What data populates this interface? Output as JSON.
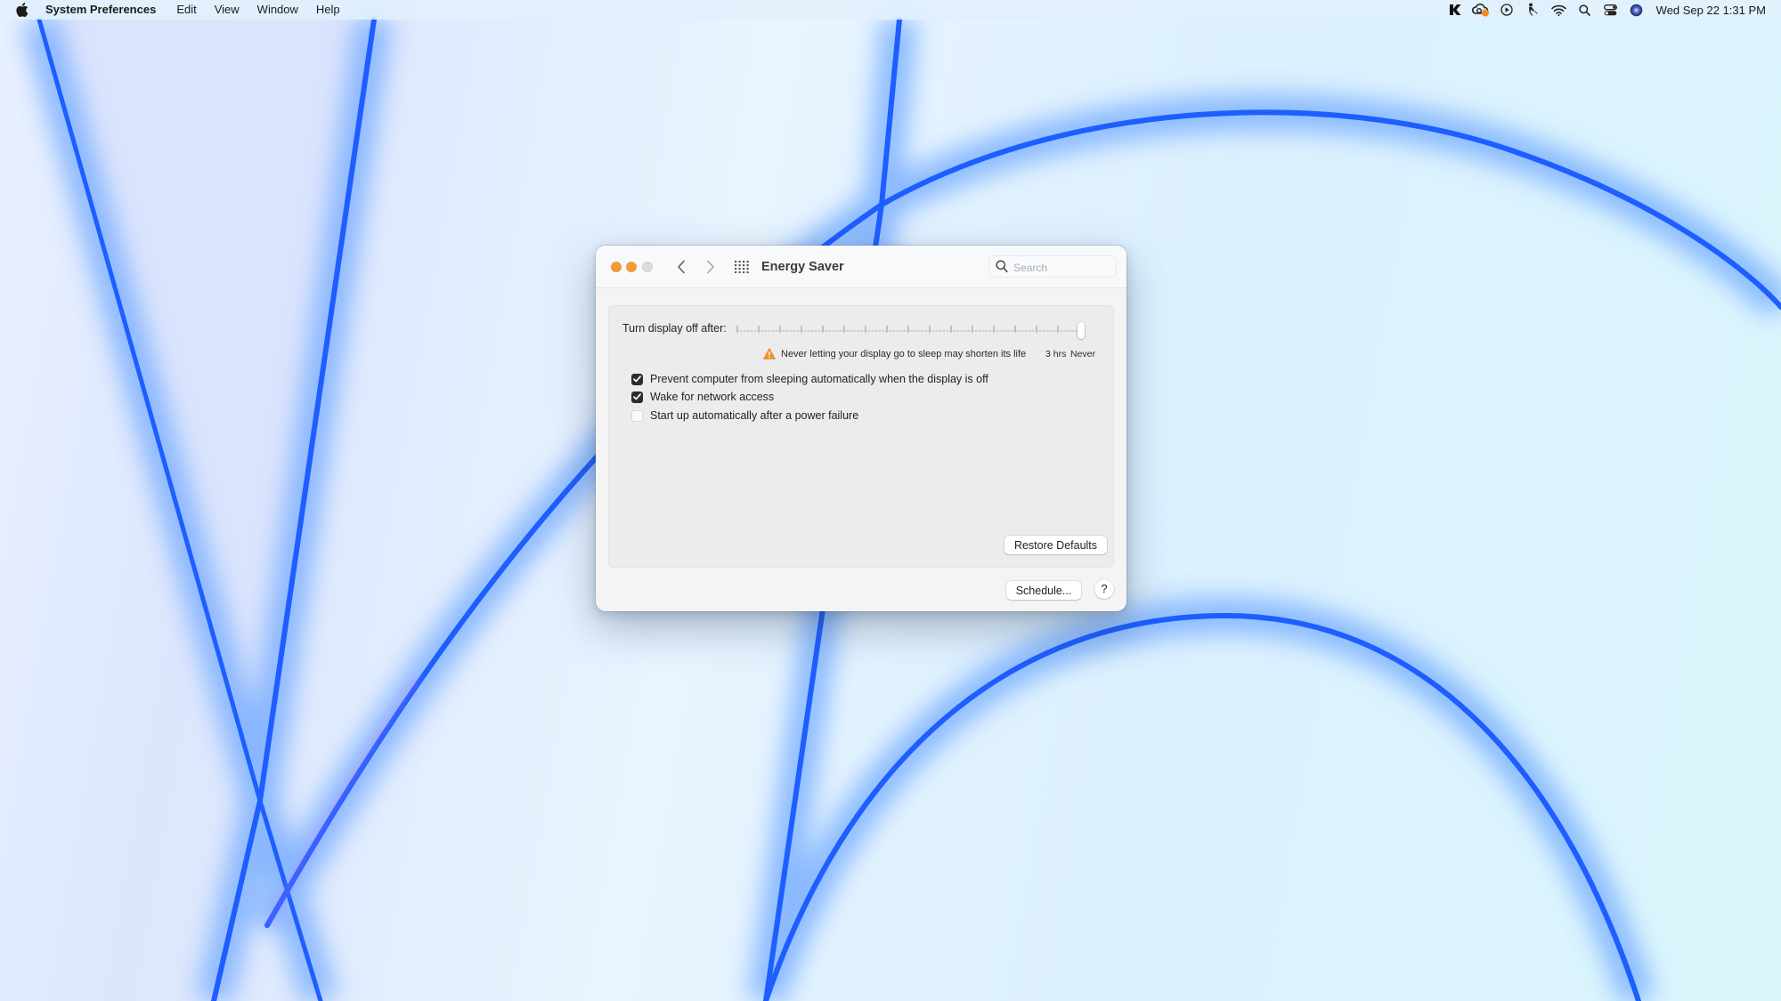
{
  "menubar": {
    "apple_icon": "apple-logo-icon",
    "app_name": "System Preferences",
    "menus": [
      "Edit",
      "View",
      "Window",
      "Help"
    ],
    "status_icons": [
      "klokki-icon",
      "creative-cloud-icon",
      "play-circle-icon",
      "voice-control-icon",
      "wifi-icon",
      "spotlight-search-icon",
      "control-center-icon",
      "siri-icon"
    ],
    "clock": "Wed Sep 22  1:31 PM"
  },
  "window": {
    "title": "Energy Saver",
    "search": {
      "placeholder": "Search",
      "value": ""
    },
    "slider": {
      "label": "Turn display off after:",
      "value": "Never",
      "position_fraction": 1.0,
      "tick_count": 16,
      "tick_labels": [
        "3 hrs",
        "Never"
      ],
      "warning": "Never letting your display go to sleep may shorten its life"
    },
    "options": [
      {
        "label": "Prevent computer from sleeping automatically when the display is off",
        "checked": true
      },
      {
        "label": "Wake for network access",
        "checked": true
      },
      {
        "label": "Start up automatically after a power failure",
        "checked": false
      }
    ],
    "restore_defaults_label": "Restore Defaults",
    "schedule_label": "Schedule...",
    "help_label": "?"
  },
  "colors": {
    "traffic_close": "#f29a3a",
    "traffic_minimize": "#f29a3a",
    "traffic_zoom": "#dcdcde",
    "warning": "#f0912e",
    "checkbox_checked": "#2a2d34",
    "wallpaper_accent": "#1e5eff"
  }
}
